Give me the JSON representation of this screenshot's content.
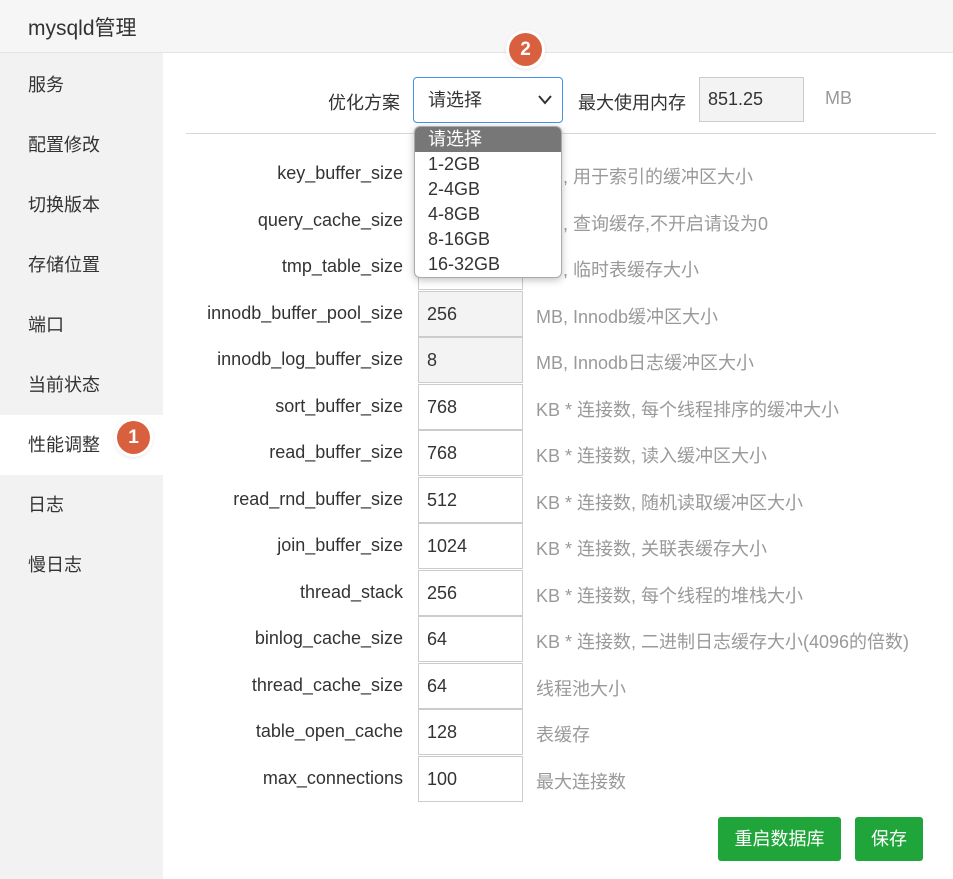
{
  "window": {
    "title": "mysqld管理"
  },
  "sidebar": {
    "items": [
      {
        "label": "服务"
      },
      {
        "label": "配置修改"
      },
      {
        "label": "切换版本"
      },
      {
        "label": "存储位置"
      },
      {
        "label": "端口"
      },
      {
        "label": "当前状态"
      },
      {
        "label": "性能调整",
        "active": true
      },
      {
        "label": "日志"
      },
      {
        "label": "慢日志"
      }
    ]
  },
  "annotations": {
    "badge1": "1",
    "badge2": "2"
  },
  "optimize": {
    "label": "优化方案",
    "selected": "请选择",
    "options": [
      "请选择",
      "1-2GB",
      "2-4GB",
      "4-8GB",
      "8-16GB",
      "16-32GB"
    ],
    "max_mem_label": "最大使用内存",
    "max_mem_value": "851.25",
    "max_mem_unit": "MB"
  },
  "params": [
    {
      "name": "key_buffer_size",
      "value": "",
      "hint": "MB, 用于索引的缓冲区大小"
    },
    {
      "name": "query_cache_size",
      "value": "",
      "hint": "MB, 查询缓存,不开启请设为0"
    },
    {
      "name": "tmp_table_size",
      "value": "",
      "hint": "MB, 临时表缓存大小"
    },
    {
      "name": "innodb_buffer_pool_size",
      "value": "256",
      "hint": "MB, Innodb缓冲区大小"
    },
    {
      "name": "innodb_log_buffer_size",
      "value": "8",
      "hint": "MB, Innodb日志缓冲区大小"
    },
    {
      "name": "sort_buffer_size",
      "value": "768",
      "hint": "KB * 连接数, 每个线程排序的缓冲大小"
    },
    {
      "name": "read_buffer_size",
      "value": "768",
      "hint": "KB * 连接数, 读入缓冲区大小"
    },
    {
      "name": "read_rnd_buffer_size",
      "value": "512",
      "hint": "KB * 连接数, 随机读取缓冲区大小"
    },
    {
      "name": "join_buffer_size",
      "value": "1024",
      "hint": "KB * 连接数, 关联表缓存大小"
    },
    {
      "name": "thread_stack",
      "value": "256",
      "hint": "KB * 连接数, 每个线程的堆栈大小"
    },
    {
      "name": "binlog_cache_size",
      "value": "64",
      "hint": "KB * 连接数, 二进制日志缓存大小(4096的倍数)"
    },
    {
      "name": "thread_cache_size",
      "value": "64",
      "hint": "线程池大小"
    },
    {
      "name": "table_open_cache",
      "value": "128",
      "hint": "表缓存"
    },
    {
      "name": "max_connections",
      "value": "100",
      "hint": "最大连接数"
    }
  ],
  "buttons": {
    "restart": "重启数据库",
    "save": "保存"
  },
  "colors": {
    "accent_green": "#20a53a",
    "badge": "#d9603f",
    "select_border": "#4a90e2"
  }
}
